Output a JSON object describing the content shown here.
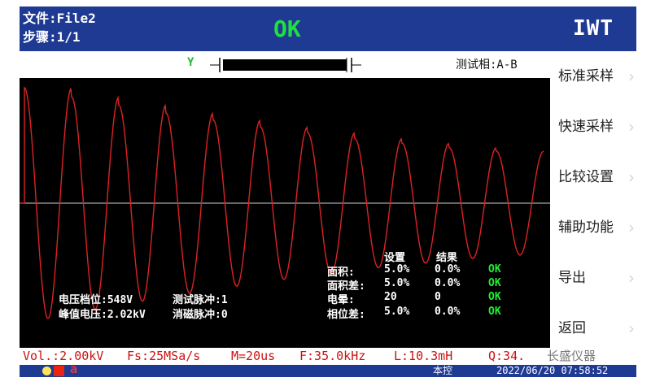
{
  "header": {
    "file": "文件:File2",
    "step": "步骤:1/1",
    "result": "OK",
    "brand": "IWT"
  },
  "topbar": {
    "channel": "Y",
    "phase": "测试相:A-B"
  },
  "menu": {
    "items": [
      "标准采样",
      "快速采样",
      "比较设置",
      "辅助功能",
      "导出",
      "返回"
    ]
  },
  "overlay": {
    "voltage_label": "电压档位:548V",
    "pulse_label": "测试脉冲:1",
    "peak_label": "峰值电压:2.02kV",
    "demag_label": "消磁脉冲:0",
    "table": {
      "headers": [
        "设置",
        "结果"
      ],
      "rows": [
        {
          "name": "面积:",
          "set": "5.0%",
          "result": "0.0%",
          "status": "OK"
        },
        {
          "name": "面积差:",
          "set": "5.0%",
          "result": "0.0%",
          "status": "OK"
        },
        {
          "name": "电晕:",
          "set": "20",
          "result": "0",
          "status": "OK"
        },
        {
          "name": "相位差:",
          "set": "5.0%",
          "result": "0.0%",
          "status": "OK"
        }
      ]
    }
  },
  "params": {
    "vol": "Vol.:2.00kV",
    "fs": "Fs:25MSa/s",
    "m": "M=20us",
    "f": "F:35.0kHz",
    "l": "L:10.3mH",
    "q": "Q:34.",
    "watermark": "长盛仪器"
  },
  "footer": {
    "mode": "本控",
    "datetime": "2022/06/20 07:58:52",
    "alpha": "a"
  },
  "chart_data": {
    "type": "line",
    "description_note": "",
    "series": [
      {
        "name": "",
        "x": [
          0,
          1,
          2,
          3,
          4,
          5,
          6,
          7,
          8,
          9,
          10
        ],
        "values": [
          1.0,
          0.92,
          0.85,
          0.78,
          0.72,
          0.66,
          0.61,
          0.56,
          0.52,
          0.48,
          0.45
        ]
      }
    ],
    "colors": {
      "trace": "#dd2222",
      "baseline": "#cfcfcf",
      "background": "#000000"
    }
  }
}
